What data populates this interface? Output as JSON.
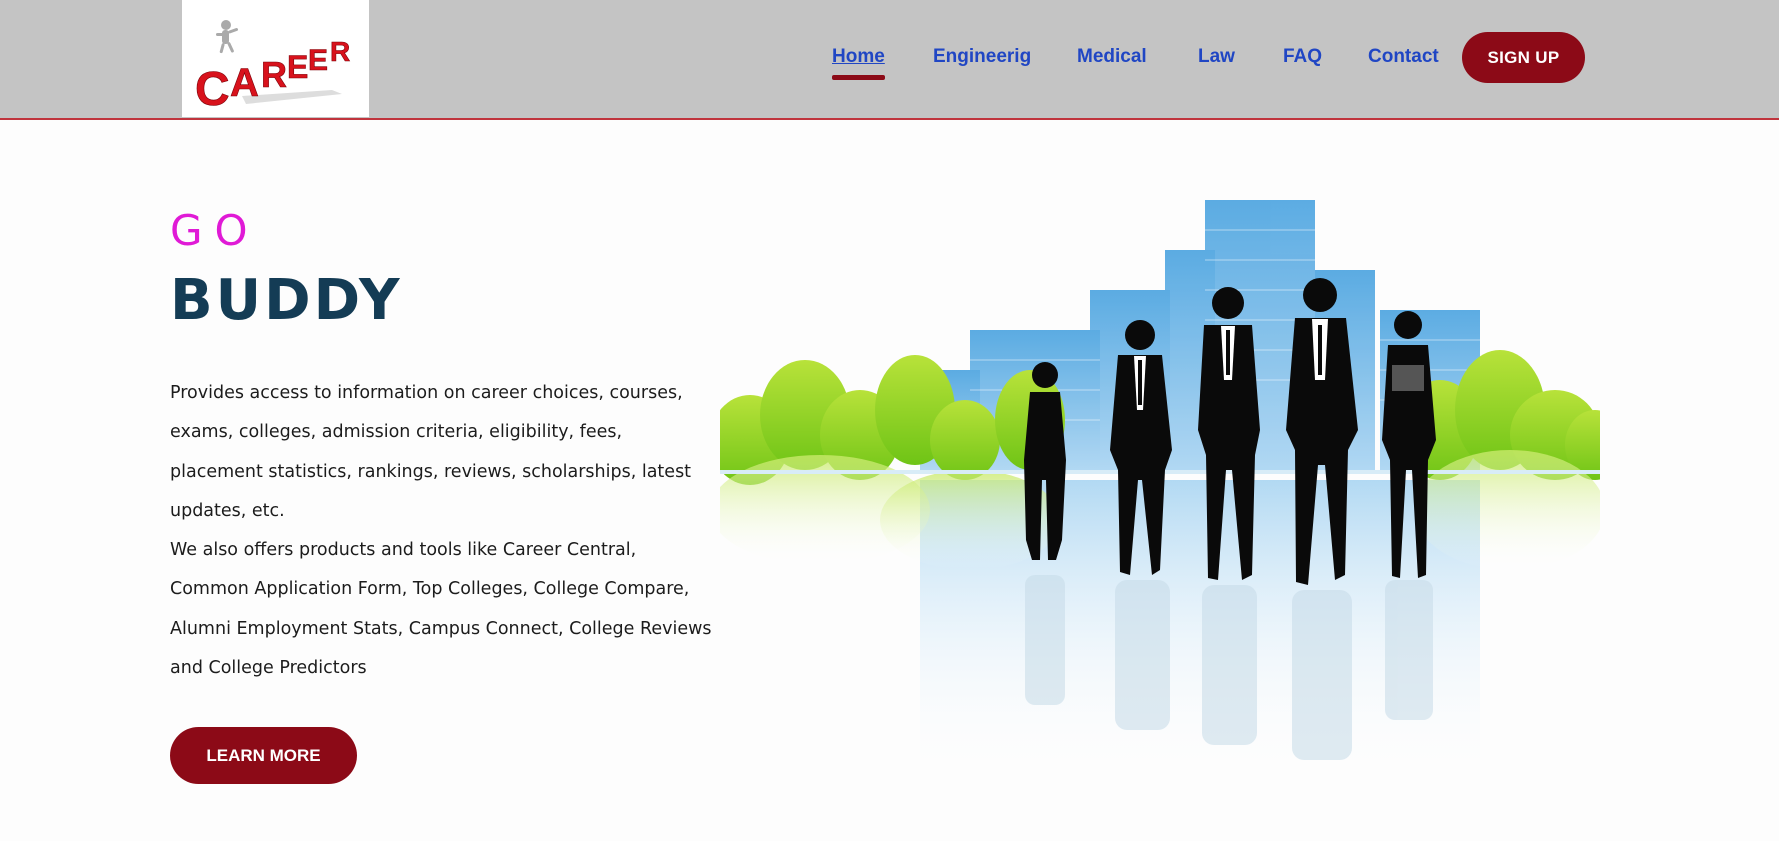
{
  "header": {
    "logo_text": "CAREER",
    "nav": [
      {
        "label": "Home",
        "active": true
      },
      {
        "label": "Engineerig",
        "active": false
      },
      {
        "label": "Medical",
        "active": false
      },
      {
        "label": "Law",
        "active": false
      },
      {
        "label": "FAQ",
        "active": false
      },
      {
        "label": "Contact",
        "active": false
      }
    ],
    "signup_label": "SIGN UP"
  },
  "hero": {
    "go": "GO",
    "title": "BUDDY",
    "paragraph1": "Provides access to information on career choices, courses, exams, colleges, admission criteria, eligibility, fees, placement statistics, rankings, reviews, scholarships, latest updates, etc.",
    "paragraph2": "We also offers products and tools like Career Central, Common Application Form, Top Colleges, College Compare, Alumni Employment Stats, Campus Connect, College Reviews and College Predictors",
    "cta_label": "LEARN MORE"
  },
  "colors": {
    "header_bg": "#c4c4c4",
    "nav_link": "#2046c4",
    "accent": "#8c0a17",
    "go_color": "#e01ad6",
    "title_color": "#143c55"
  }
}
